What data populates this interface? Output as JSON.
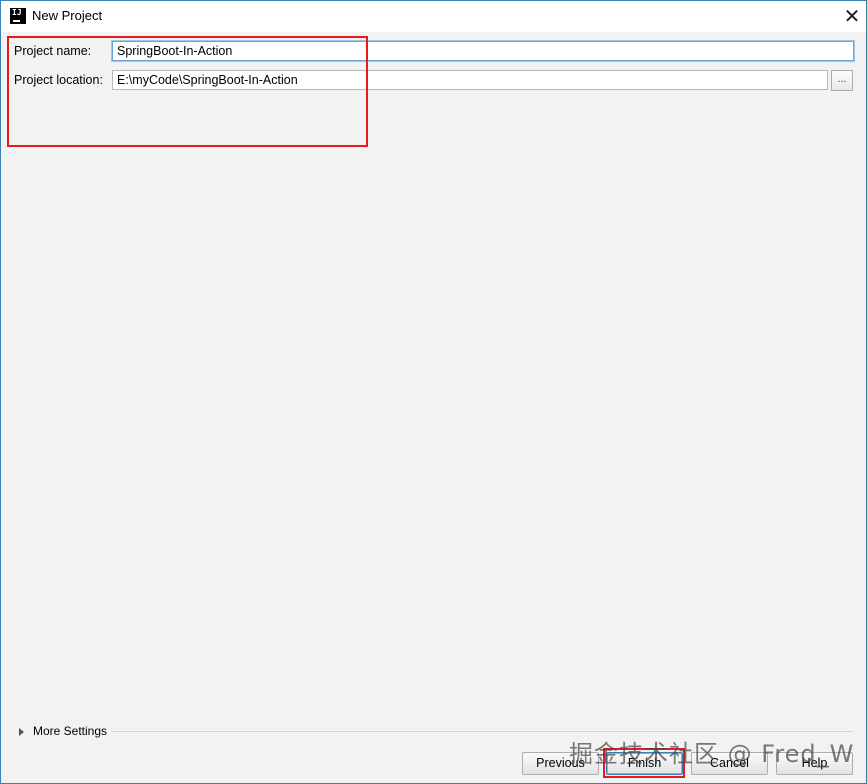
{
  "window": {
    "title": "New Project",
    "app_icon": "intellij-idea-icon",
    "close_symbol": "✕"
  },
  "form": {
    "project_name_label": "Project name:",
    "project_name_value": "SpringBoot-In-Action",
    "project_location_label": "Project location:",
    "project_location_value": "E:\\myCode\\SpringBoot-In-Action",
    "browse_label": "..."
  },
  "more_settings": {
    "label": "More Settings",
    "icon": "expand-triangle-icon"
  },
  "buttons": {
    "previous": "Previous",
    "finish": "Finish",
    "cancel": "Cancel",
    "help": "Help"
  },
  "watermark": "掘金技术社区 @ Fred_W",
  "colors": {
    "annotation_red": "#e8191f",
    "focus_blue": "#6aa6dd",
    "window_border": "#3c7fb1"
  }
}
